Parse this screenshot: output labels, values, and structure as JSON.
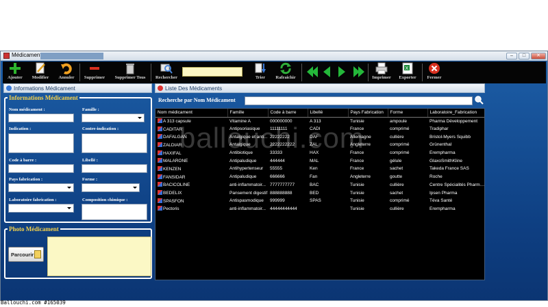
{
  "window": {
    "title": "Médicament"
  },
  "toolbar": {
    "ajouter": "Ajouter",
    "modifier": "Modifier",
    "annuler": "Annuler",
    "supprimer": "Supprimer",
    "supprimer_tous": "Supprimer Tous",
    "rechercher": "Rechercher",
    "trier": "Trier",
    "rafraichir": "Rafraichir",
    "imprimer": "Imprimer",
    "exporter": "Exporter",
    "fermer": "Fermer"
  },
  "left_panel": {
    "header": "Informations Médicament",
    "group_title": "Informations Médicament",
    "labels": {
      "nom": "Nom médicament :",
      "famille": "Famille :",
      "indication": "Indication :",
      "contre_indication": "Contre-indication :",
      "code_barre": "Code à barre :",
      "libelle": "Libellé :",
      "pays": "Pays fabrication :",
      "forme": "Forme :",
      "laboratoire": "Laboratoire fabrication :",
      "composition": "Composition chimique :"
    },
    "photo_group_title": "Photo Médicament",
    "browse_label": "Parcourir"
  },
  "right_panel": {
    "header": "Liste Des Médicaments",
    "search_label": "Recherche par Nom Médicament",
    "columns": [
      "Nom médicament",
      "Famille",
      "Code à barre",
      "Libellé",
      "Pays Fabrication",
      "Forme",
      "Laboratoire_Fabrication"
    ],
    "rows": [
      [
        "A 313 capsule",
        "Vitamine A",
        "000000000",
        "A 313",
        "Tunisie",
        "ampoule",
        "Pharma Développement"
      ],
      [
        "CADITAR",
        "Antipsoriasique",
        "11111111",
        "CADI",
        "France",
        "comprimé",
        "Tradiphar"
      ],
      [
        "DAFALGAN",
        "Antalgique et anti...",
        "22222222",
        "DAF",
        "Allemagne",
        "cullière",
        "Bristol-Myers Squibb"
      ],
      [
        "ZALDIAR",
        "Antalgique",
        "2222222222",
        "ZAL",
        "Angleterre",
        "comprimé",
        "Grünenthal"
      ],
      [
        "HAXIFAL",
        "Antibiotique",
        "33333",
        "HAX",
        "France",
        "comprimé",
        "Erempharma"
      ],
      [
        "MALARONE",
        "Antipaludique",
        "444444",
        "MAL",
        "France",
        "gélule",
        "GlaxoSmithKline"
      ],
      [
        "KENZEN",
        "Antihypertenseur",
        "55555",
        "Ken",
        "France",
        "sachet",
        "Takeda France SAS"
      ],
      [
        "FANSIDAR",
        "Antipaludique",
        "666666",
        "Fan",
        "Angleterre",
        "goutte",
        "Roche"
      ],
      [
        "BACICOLINE",
        "anti-inflammatoir...",
        "7777777777",
        "BAC",
        "Tunisie",
        "cullière",
        "Centre Spécialités Pharma..."
      ],
      [
        "BEDELIX",
        "Pansement digestif",
        "888888888",
        "BED",
        "Tunisie",
        "sachet",
        "Ipsen Pharma"
      ],
      [
        "SPASFON",
        "Antispasmodique",
        "999999",
        "SPAS",
        "Tunisie",
        "comprimé",
        "Téva Santé"
      ],
      [
        "Pectoris",
        "anti-inflammatoir...",
        "44444444444",
        "",
        "Tunisie",
        "cullière",
        "Erempharma"
      ]
    ]
  },
  "watermark": "ballouchi.com",
  "footer": "Ballouchi.com #165039",
  "colors": {
    "background": "#0e3f82",
    "accent": "#f6d24a",
    "grid_bg": "#000000"
  }
}
